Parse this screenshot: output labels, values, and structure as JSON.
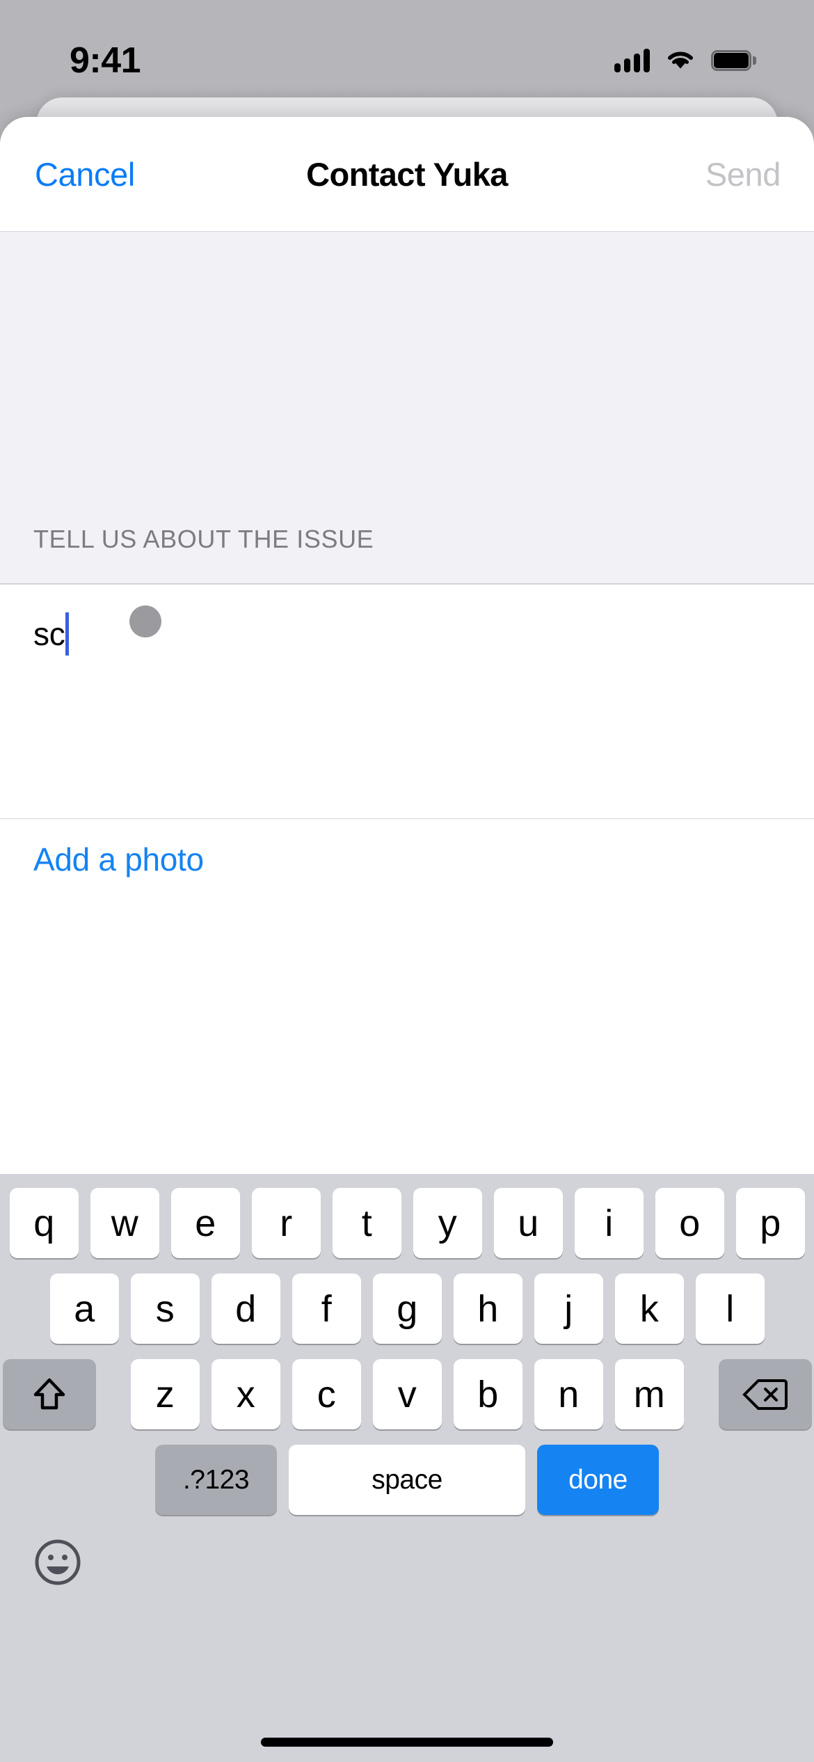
{
  "status_bar": {
    "time": "9:41",
    "cellular_icon": "cellular-signal-icon",
    "wifi_icon": "wifi-icon",
    "battery_icon": "battery-icon"
  },
  "navbar": {
    "cancel_label": "Cancel",
    "title": "Contact Yuka",
    "send_label": "Send",
    "send_disabled": true
  },
  "form": {
    "section_label": "TELL US ABOUT THE ISSUE",
    "text_value": "sc",
    "text_placeholder": "",
    "add_photo_label": "Add a photo"
  },
  "touch_indicator": {
    "name": "touch-point-indicator",
    "color": "#9b9b9f"
  },
  "keyboard": {
    "row1": [
      "q",
      "w",
      "e",
      "r",
      "t",
      "y",
      "u",
      "i",
      "o",
      "p"
    ],
    "row2": [
      "a",
      "s",
      "d",
      "f",
      "g",
      "h",
      "j",
      "k",
      "l"
    ],
    "row3": [
      "z",
      "x",
      "c",
      "v",
      "b",
      "n",
      "m"
    ],
    "shift_icon": "shift-arrow-icon",
    "backspace_icon": "backspace-icon",
    "numbers_label": ".?123",
    "space_label": "space",
    "done_label": "done",
    "emoji_icon": "emoji-smiley-icon"
  },
  "colors": {
    "accent_blue": "#1583f2",
    "cancel_blue": "#0a7cf6",
    "disabled_gray": "#c3c3c7",
    "keyboard_bg": "#d1d3d9",
    "form_bg": "#f1f1f6",
    "caret_blue": "#3b5ee0"
  }
}
